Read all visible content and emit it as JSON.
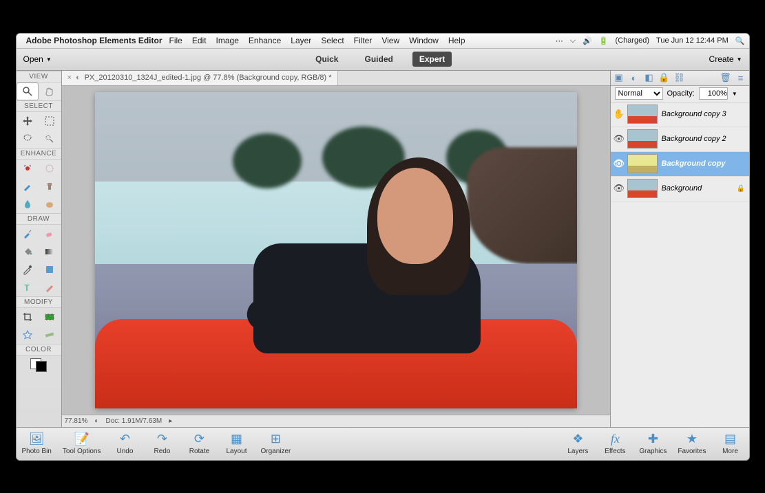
{
  "menubar": {
    "appname": "Adobe Photoshop Elements Editor",
    "items": [
      "File",
      "Edit",
      "Image",
      "Enhance",
      "Layer",
      "Select",
      "Filter",
      "View",
      "Window",
      "Help"
    ],
    "battery": "(Charged)",
    "datetime": "Tue Jun 12  12:44 PM"
  },
  "topbar": {
    "open": "Open",
    "create": "Create",
    "modes": {
      "quick": "Quick",
      "guided": "Guided",
      "expert": "Expert"
    }
  },
  "doctab": {
    "title": "PX_20120310_1324J_edited-1.jpg @ 77.8% (Background copy, RGB/8) *"
  },
  "toolcol": {
    "view": "VIEW",
    "select": "SELECT",
    "enhance": "ENHANCE",
    "draw": "DRAW",
    "modify": "MODIFY",
    "color": "COLOR"
  },
  "status": {
    "zoom": "77.81%",
    "doc": "Doc: 1.91M/7.63M"
  },
  "layerspanel": {
    "blend": "Normal",
    "opacity_label": "Opacity:",
    "opacity_value": "100%",
    "layers": [
      {
        "name": "Background copy 3",
        "visible": false
      },
      {
        "name": "Background copy 2",
        "visible": true
      },
      {
        "name": "Background copy",
        "visible": true,
        "active": true
      },
      {
        "name": "Background",
        "visible": true,
        "locked": true
      }
    ]
  },
  "bottombar": {
    "photobin": "Photo Bin",
    "toolopt": "Tool Options",
    "undo": "Undo",
    "redo": "Redo",
    "rotate": "Rotate",
    "layout": "Layout",
    "organizer": "Organizer",
    "layers": "Layers",
    "effects": "Effects",
    "graphics": "Graphics",
    "favorites": "Favorites",
    "more": "More"
  }
}
